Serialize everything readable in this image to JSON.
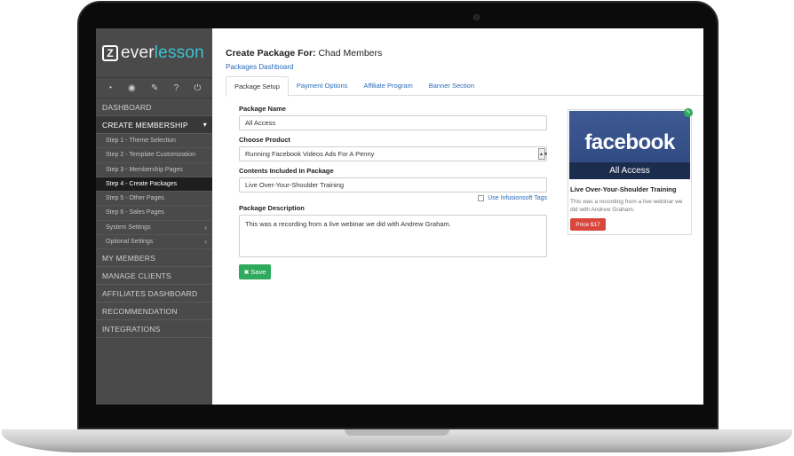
{
  "brand": {
    "logo_mark": "Z",
    "logo_prefix": "ever",
    "logo_suffix": "lesson"
  },
  "toolbar_icons": [
    "dashboard-gauge-icon",
    "eye-icon",
    "pencil-icon",
    "help-icon",
    "power-icon"
  ],
  "sidebar": {
    "dashboard": "DASHBOARD",
    "create_membership": "CREATE MEMBERSHIP",
    "steps": [
      "Step 1 - Theme Selection",
      "Step 2 - Template Customization",
      "Step 3 - Membership Pages",
      "Step 4 - Create Packages",
      "Step 5 - Other Pages",
      "Step 6 - Sales Pages",
      "System Settings",
      "Optional Settings"
    ],
    "sections": [
      "MY MEMBERS",
      "MANAGE CLIENTS",
      "AFFILIATES DASHBOARD",
      "RECOMMENDATION",
      "INTEGRATIONS"
    ]
  },
  "header": {
    "title_label": "Create Package For:",
    "title_value": "Chad Members",
    "breadcrumb": "Packages Dashboard"
  },
  "tabs": [
    "Package Setup",
    "Payment Options",
    "Affiliate Program",
    "Banner Section"
  ],
  "form": {
    "package_name_label": "Package Name",
    "package_name_value": "All Access",
    "product_label": "Choose Product",
    "product_value": "Running Facebook Videos Ads For A Penny",
    "contents_label": "Contents Included In Package",
    "contents_value": "Live Over-Your-Shoulder Training",
    "infusionsoft_label": "Use Infusionsoft Tags",
    "description_label": "Package Description",
    "description_value": "This was a recording from a live webinar we did with Andrew Graham.",
    "save_label": "Save"
  },
  "card": {
    "image_text": "facebook",
    "image_band": "All Access",
    "title": "Live Over-Your-Shoulder Training",
    "description": "This was a recording from a live webinar we did with Andrew Graham.",
    "price_label": "Price $17"
  },
  "colors": {
    "accent": "#2a6ab8",
    "save": "#2eaa5d",
    "price": "#d9463c",
    "sidebar": "#4a4a4a"
  }
}
